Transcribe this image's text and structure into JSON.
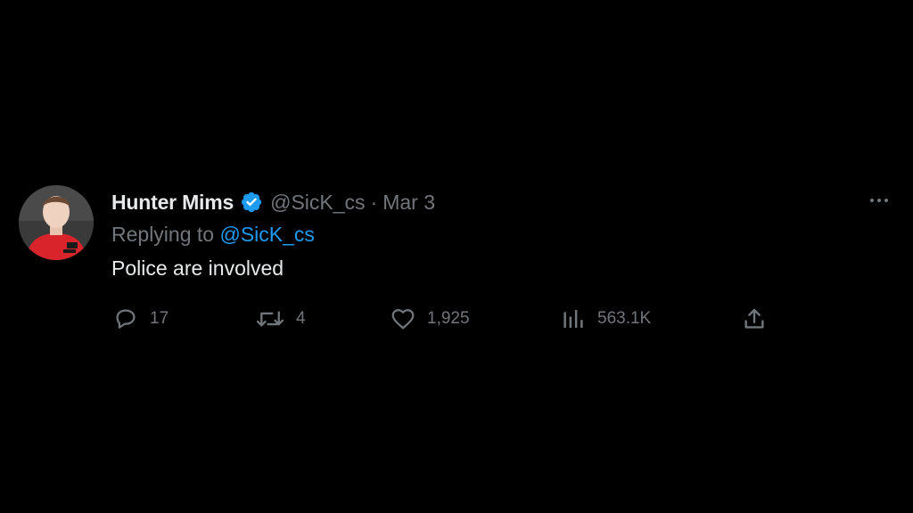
{
  "tweet": {
    "display_name": "Hunter Mims",
    "handle": "@SicK_cs",
    "separator": "·",
    "date": "Mar 3",
    "reply_prefix": "Replying to",
    "reply_handle": "@SicK_cs",
    "text": "Police are involved"
  },
  "actions": {
    "replies": "17",
    "retweets": "4",
    "likes": "1,925",
    "views": "563.1K"
  },
  "icons": {
    "verified": "verified-badge-icon",
    "more": "more-horizontal-icon",
    "reply": "reply-bubble-icon",
    "retweet": "retweet-icon",
    "like": "heart-icon",
    "views": "bar-chart-icon",
    "share": "share-upload-icon"
  },
  "colors": {
    "background": "#000000",
    "text_primary": "#e7e9ea",
    "text_secondary": "#71767b",
    "accent": "#1d9bf0"
  }
}
